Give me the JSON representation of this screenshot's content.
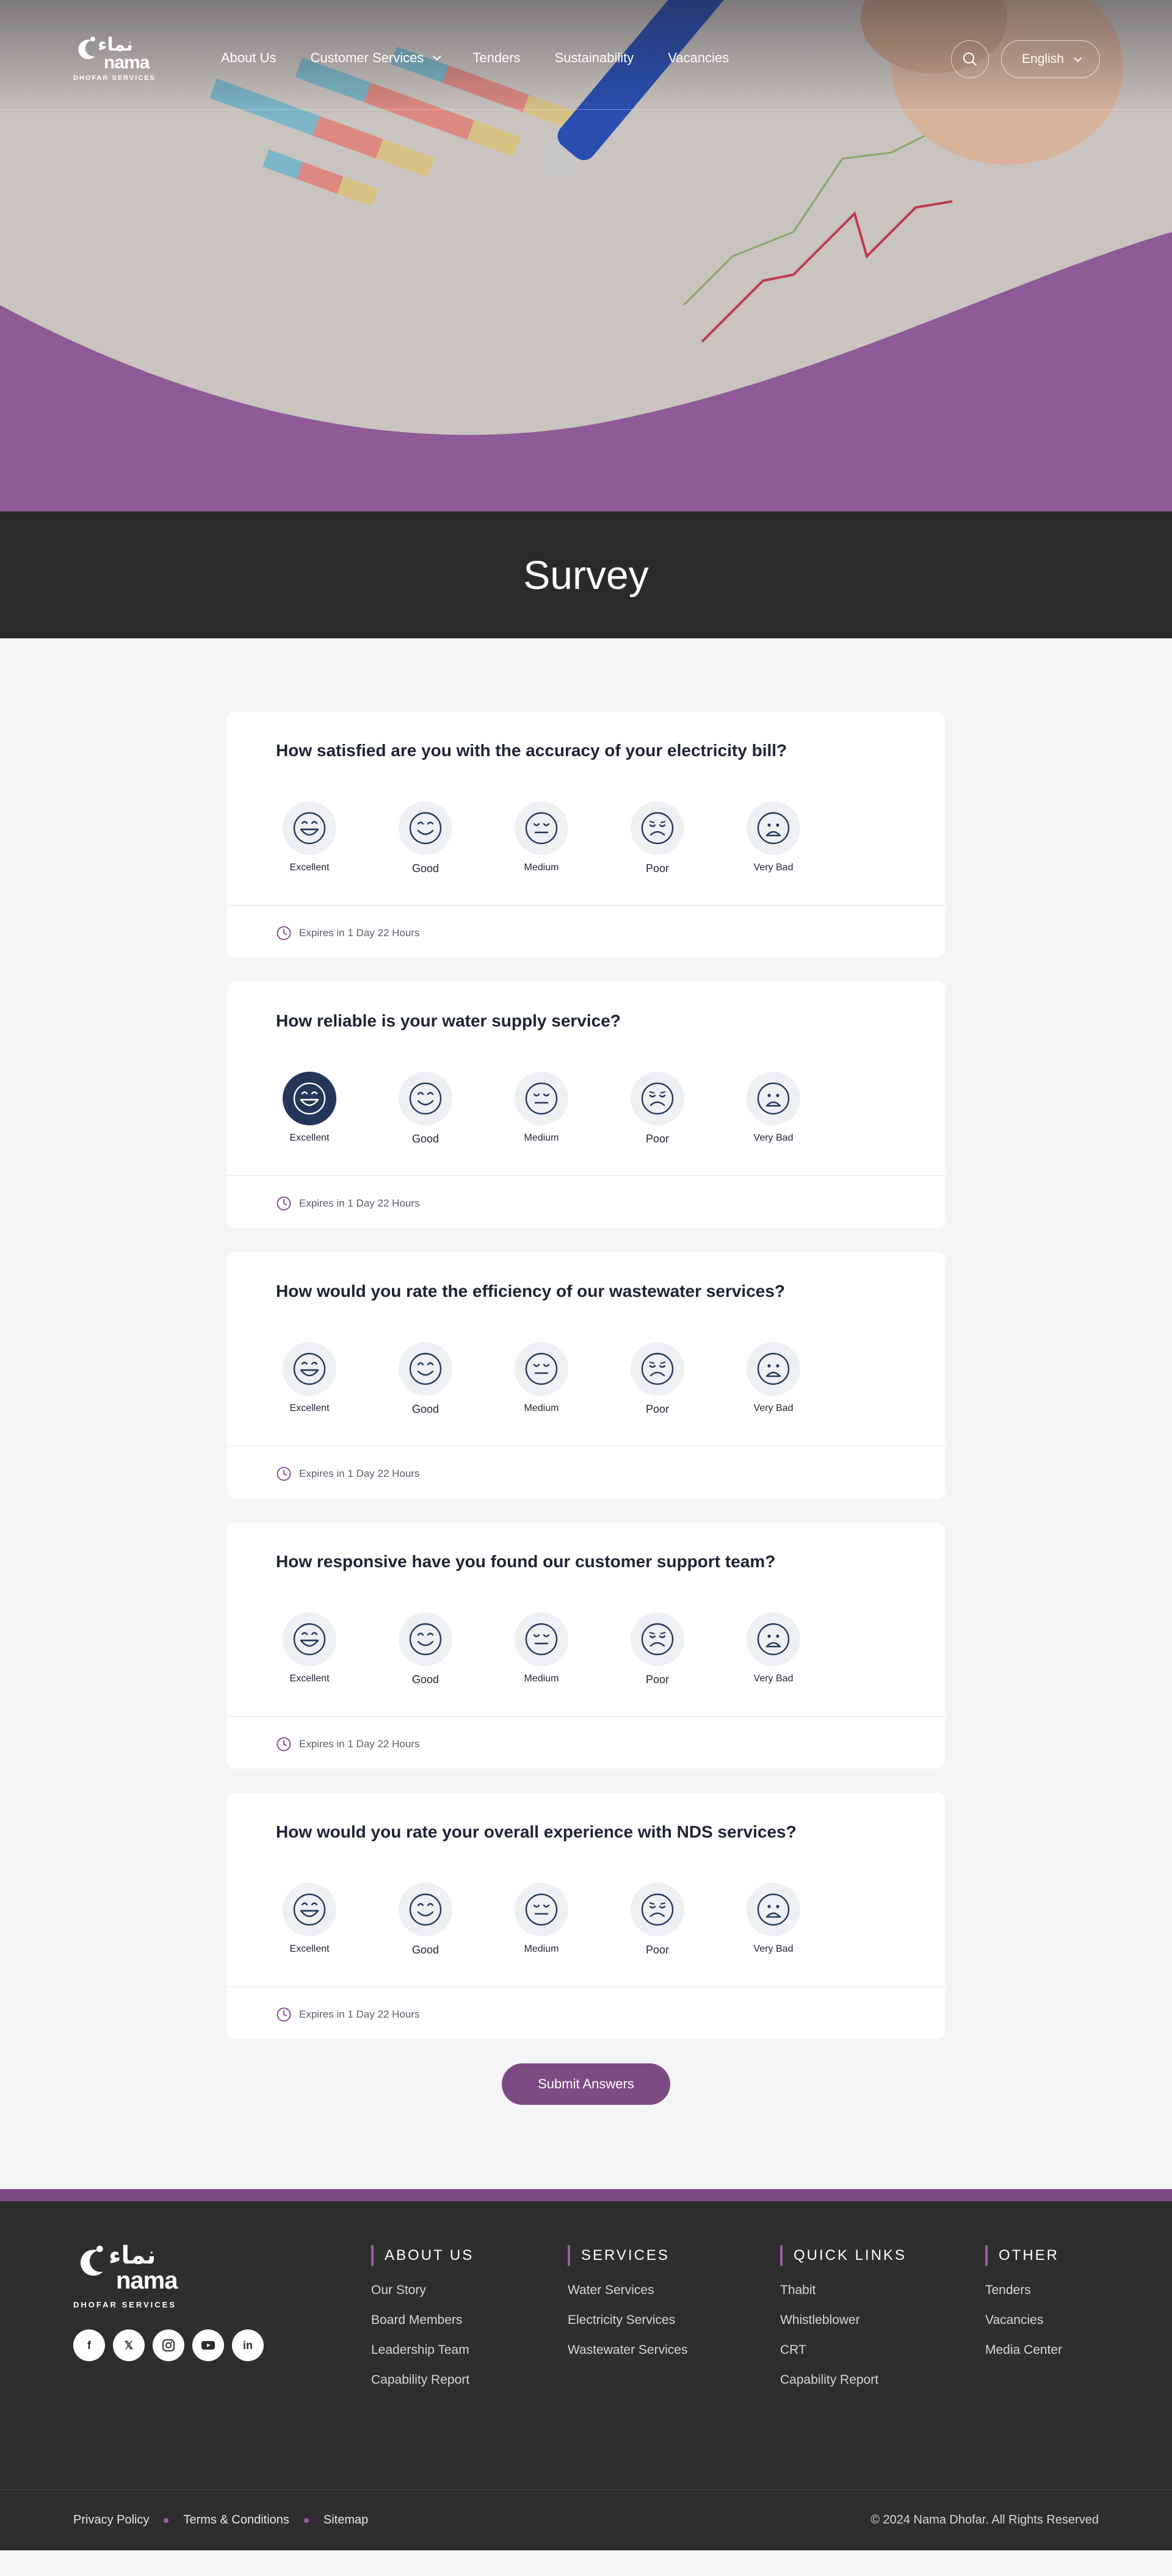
{
  "header": {
    "logo_arabic": "نماء",
    "logo_english": "nama",
    "logo_sub": "DHOFAR SERVICES",
    "nav": [
      {
        "label": "About Us",
        "has_dropdown": false
      },
      {
        "label": "Customer Services",
        "has_dropdown": true
      },
      {
        "label": "Tenders",
        "has_dropdown": false
      },
      {
        "label": "Sustainability",
        "has_dropdown": false
      },
      {
        "label": "Vacancies",
        "has_dropdown": false
      }
    ],
    "search_icon": "search-icon",
    "language": "English"
  },
  "page_title": "Survey",
  "survey": {
    "options": [
      "Excellent",
      "Good",
      "Medium",
      "Poor",
      "Very Bad"
    ],
    "questions": [
      {
        "question": "How satisfied are you with the accuracy of your electricity bill?",
        "selected": null,
        "expiry": "Expires in 1 Day 22 Hours"
      },
      {
        "question": "How reliable is your water supply service?",
        "selected": "Excellent",
        "expiry": "Expires in 1 Day 22 Hours"
      },
      {
        "question": "How would you rate the efficiency of our wastewater services?",
        "selected": null,
        "expiry": "Expires in 1 Day 22 Hours"
      },
      {
        "question": "How responsive have you found our customer support team?",
        "selected": null,
        "expiry": "Expires in 1 Day 22 Hours"
      },
      {
        "question": "How would you rate your overall experience with NDS services?",
        "selected": null,
        "expiry": "Expires in 1 Day 22 Hours"
      }
    ],
    "submit_label": "Submit Answers"
  },
  "colors": {
    "brand_purple": "#7e4a84",
    "selected_navy": "#24375a",
    "dark_band": "#2a2a2a"
  },
  "footer": {
    "logo_arabic": "نماء",
    "logo_english": "nama",
    "logo_sub": "DHOFAR SERVICES",
    "socials": [
      "facebook-icon",
      "x-icon",
      "instagram-icon",
      "youtube-icon",
      "linkedin-icon"
    ],
    "columns": [
      {
        "title": "ABOUT US",
        "links": [
          "Our Story",
          "Board Members",
          "Leadership Team",
          "Capability Report"
        ]
      },
      {
        "title": "SERVICES",
        "links": [
          "Water Services",
          "Electricity Services",
          "Wastewater Services"
        ]
      },
      {
        "title": "QUICK LINKS",
        "links": [
          "Thabit",
          "Whistleblower",
          "CRT",
          "Capability Report"
        ]
      },
      {
        "title": "OTHER",
        "links": [
          "Tenders",
          "Vacancies",
          "Media Center"
        ]
      }
    ],
    "bottom_links": [
      "Privacy Policy",
      "Terms & Conditions",
      "Sitemap"
    ],
    "copyright": "© 2024 Nama Dhofar. All Rights Reserved"
  }
}
